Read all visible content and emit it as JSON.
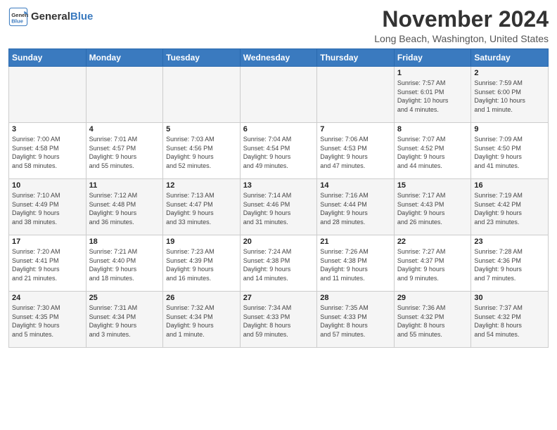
{
  "logo": {
    "line1": "General",
    "line2": "Blue"
  },
  "title": "November 2024",
  "location": "Long Beach, Washington, United States",
  "days_of_week": [
    "Sunday",
    "Monday",
    "Tuesday",
    "Wednesday",
    "Thursday",
    "Friday",
    "Saturday"
  ],
  "weeks": [
    [
      {
        "day": "",
        "info": ""
      },
      {
        "day": "",
        "info": ""
      },
      {
        "day": "",
        "info": ""
      },
      {
        "day": "",
        "info": ""
      },
      {
        "day": "",
        "info": ""
      },
      {
        "day": "1",
        "info": "Sunrise: 7:57 AM\nSunset: 6:01 PM\nDaylight: 10 hours\nand 4 minutes."
      },
      {
        "day": "2",
        "info": "Sunrise: 7:59 AM\nSunset: 6:00 PM\nDaylight: 10 hours\nand 1 minute."
      }
    ],
    [
      {
        "day": "3",
        "info": "Sunrise: 7:00 AM\nSunset: 4:58 PM\nDaylight: 9 hours\nand 58 minutes."
      },
      {
        "day": "4",
        "info": "Sunrise: 7:01 AM\nSunset: 4:57 PM\nDaylight: 9 hours\nand 55 minutes."
      },
      {
        "day": "5",
        "info": "Sunrise: 7:03 AM\nSunset: 4:56 PM\nDaylight: 9 hours\nand 52 minutes."
      },
      {
        "day": "6",
        "info": "Sunrise: 7:04 AM\nSunset: 4:54 PM\nDaylight: 9 hours\nand 49 minutes."
      },
      {
        "day": "7",
        "info": "Sunrise: 7:06 AM\nSunset: 4:53 PM\nDaylight: 9 hours\nand 47 minutes."
      },
      {
        "day": "8",
        "info": "Sunrise: 7:07 AM\nSunset: 4:52 PM\nDaylight: 9 hours\nand 44 minutes."
      },
      {
        "day": "9",
        "info": "Sunrise: 7:09 AM\nSunset: 4:50 PM\nDaylight: 9 hours\nand 41 minutes."
      }
    ],
    [
      {
        "day": "10",
        "info": "Sunrise: 7:10 AM\nSunset: 4:49 PM\nDaylight: 9 hours\nand 38 minutes."
      },
      {
        "day": "11",
        "info": "Sunrise: 7:12 AM\nSunset: 4:48 PM\nDaylight: 9 hours\nand 36 minutes."
      },
      {
        "day": "12",
        "info": "Sunrise: 7:13 AM\nSunset: 4:47 PM\nDaylight: 9 hours\nand 33 minutes."
      },
      {
        "day": "13",
        "info": "Sunrise: 7:14 AM\nSunset: 4:46 PM\nDaylight: 9 hours\nand 31 minutes."
      },
      {
        "day": "14",
        "info": "Sunrise: 7:16 AM\nSunset: 4:44 PM\nDaylight: 9 hours\nand 28 minutes."
      },
      {
        "day": "15",
        "info": "Sunrise: 7:17 AM\nSunset: 4:43 PM\nDaylight: 9 hours\nand 26 minutes."
      },
      {
        "day": "16",
        "info": "Sunrise: 7:19 AM\nSunset: 4:42 PM\nDaylight: 9 hours\nand 23 minutes."
      }
    ],
    [
      {
        "day": "17",
        "info": "Sunrise: 7:20 AM\nSunset: 4:41 PM\nDaylight: 9 hours\nand 21 minutes."
      },
      {
        "day": "18",
        "info": "Sunrise: 7:21 AM\nSunset: 4:40 PM\nDaylight: 9 hours\nand 18 minutes."
      },
      {
        "day": "19",
        "info": "Sunrise: 7:23 AM\nSunset: 4:39 PM\nDaylight: 9 hours\nand 16 minutes."
      },
      {
        "day": "20",
        "info": "Sunrise: 7:24 AM\nSunset: 4:38 PM\nDaylight: 9 hours\nand 14 minutes."
      },
      {
        "day": "21",
        "info": "Sunrise: 7:26 AM\nSunset: 4:38 PM\nDaylight: 9 hours\nand 11 minutes."
      },
      {
        "day": "22",
        "info": "Sunrise: 7:27 AM\nSunset: 4:37 PM\nDaylight: 9 hours\nand 9 minutes."
      },
      {
        "day": "23",
        "info": "Sunrise: 7:28 AM\nSunset: 4:36 PM\nDaylight: 9 hours\nand 7 minutes."
      }
    ],
    [
      {
        "day": "24",
        "info": "Sunrise: 7:30 AM\nSunset: 4:35 PM\nDaylight: 9 hours\nand 5 minutes."
      },
      {
        "day": "25",
        "info": "Sunrise: 7:31 AM\nSunset: 4:34 PM\nDaylight: 9 hours\nand 3 minutes."
      },
      {
        "day": "26",
        "info": "Sunrise: 7:32 AM\nSunset: 4:34 PM\nDaylight: 9 hours\nand 1 minute."
      },
      {
        "day": "27",
        "info": "Sunrise: 7:34 AM\nSunset: 4:33 PM\nDaylight: 8 hours\nand 59 minutes."
      },
      {
        "day": "28",
        "info": "Sunrise: 7:35 AM\nSunset: 4:33 PM\nDaylight: 8 hours\nand 57 minutes."
      },
      {
        "day": "29",
        "info": "Sunrise: 7:36 AM\nSunset: 4:32 PM\nDaylight: 8 hours\nand 55 minutes."
      },
      {
        "day": "30",
        "info": "Sunrise: 7:37 AM\nSunset: 4:32 PM\nDaylight: 8 hours\nand 54 minutes."
      }
    ]
  ]
}
